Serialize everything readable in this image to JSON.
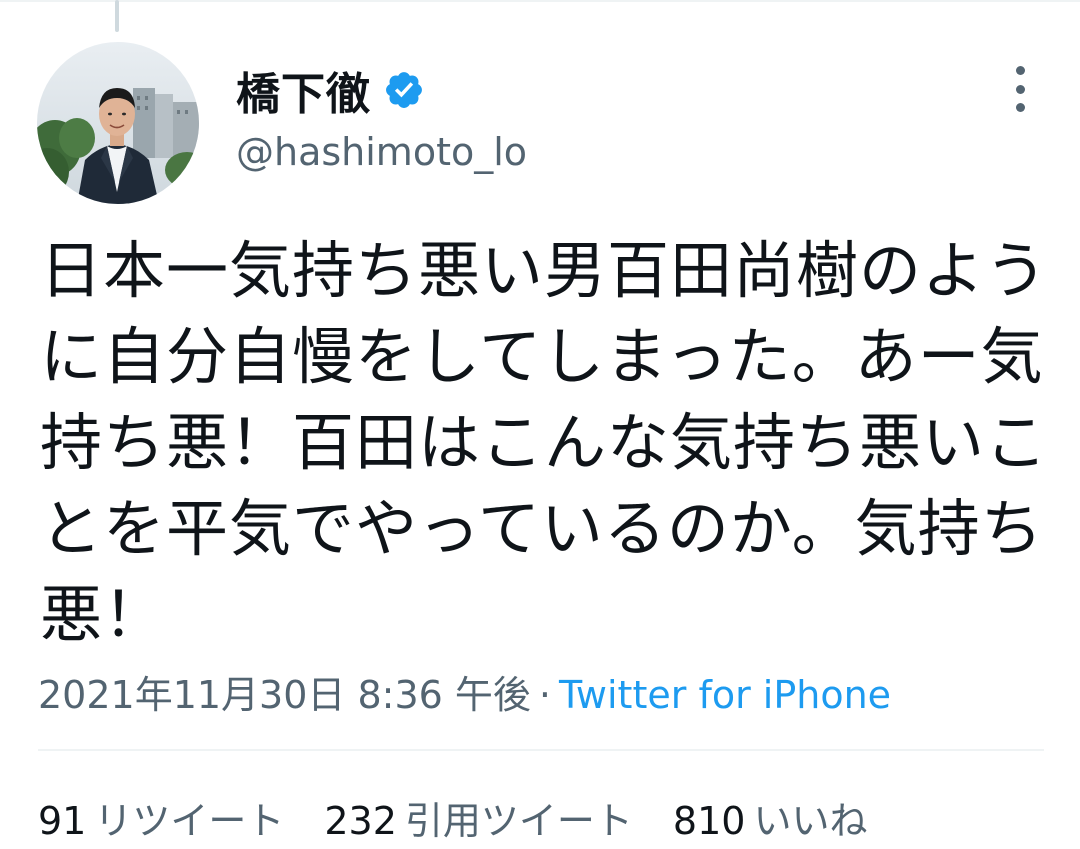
{
  "user": {
    "display_name": "橋下徹",
    "handle": "@hashimoto_lo",
    "verified": true
  },
  "tweet": {
    "text": "日本一気持ち悪い男百田尚樹のように自分自慢をしてしまった。あー気持ち悪！百田はこんな気持ち悪いことを平気でやっているのか。気持ち悪！",
    "date": "2021年11月30日 8:36 午後",
    "separator": "·",
    "source": "Twitter for iPhone"
  },
  "stats": {
    "retweets": {
      "count": "91",
      "label": "リツイート"
    },
    "quotes": {
      "count": "232",
      "label": "引用ツイート"
    },
    "likes": {
      "count": "810",
      "label": "いいね"
    }
  },
  "icons": {
    "verified": "verified-badge-icon",
    "more": "more-options-icon"
  },
  "colors": {
    "accent": "#1d9bf0",
    "text_primary": "#0f1419",
    "text_secondary": "#536471",
    "divider": "#eff3f4"
  }
}
